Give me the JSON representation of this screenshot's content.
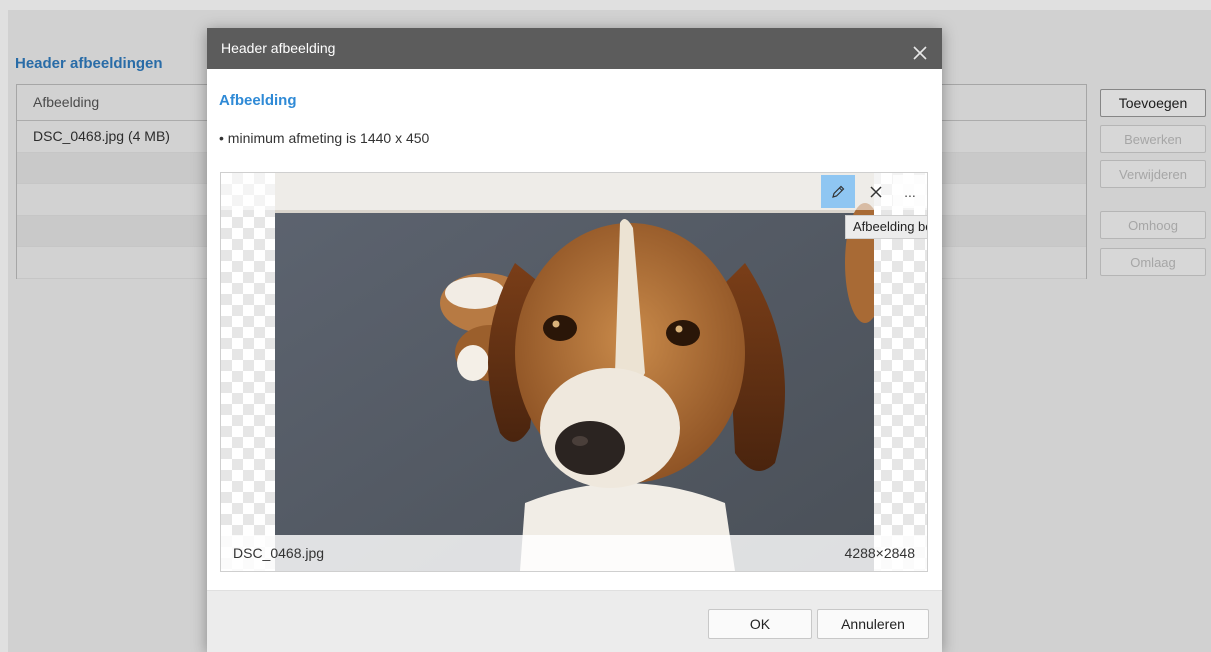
{
  "page": {
    "section_title": "Header afbeeldingen",
    "table": {
      "header": "Afbeelding",
      "rows": [
        "DSC_0468.jpg (4 MB)",
        "",
        "",
        "",
        ""
      ]
    },
    "buttons": {
      "add": "Toevoegen",
      "edit": "Bewerken",
      "delete": "Verwijderen",
      "up": "Omhoog",
      "down": "Omlaag"
    }
  },
  "dialog": {
    "title": "Header afbeelding",
    "subtitle": "Afbeelding",
    "hint": "• minimum afmeting is 1440 x 450",
    "image": {
      "toolbar": {
        "edit_icon": "pencil-icon",
        "remove_icon": "close-icon",
        "more_label": "..."
      },
      "tooltip": "Afbeelding bewerken",
      "filename": "DSC_0468.jpg",
      "dimensions": "4288×2848"
    },
    "footer": {
      "ok_label": "OK",
      "cancel_label": "Annuleren"
    }
  },
  "colors": {
    "accent": "#2f8ad6",
    "header_bg": "#5c5c5c",
    "edit_active": "#8fc6f2"
  }
}
